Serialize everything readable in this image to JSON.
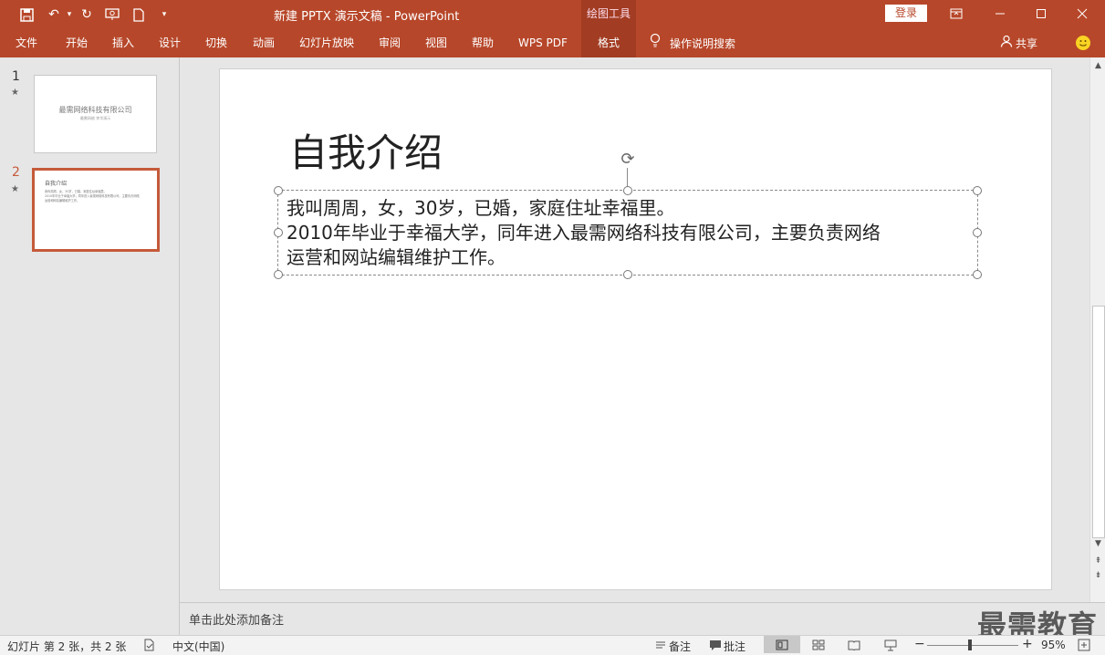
{
  "titlebar": {
    "title": "新建 PPTX 演示文稿  -  PowerPoint",
    "drawing_tools": "绘图工具",
    "login": "登录"
  },
  "ribbon": {
    "tabs": [
      {
        "label": "文件"
      },
      {
        "label": "开始"
      },
      {
        "label": "插入"
      },
      {
        "label": "设计"
      },
      {
        "label": "切换"
      },
      {
        "label": "动画"
      },
      {
        "label": "幻灯片放映"
      },
      {
        "label": "审阅"
      },
      {
        "label": "视图"
      },
      {
        "label": "帮助"
      },
      {
        "label": "WPS PDF"
      },
      {
        "label": "格式"
      }
    ],
    "tell_me": "操作说明搜索",
    "share": "共享"
  },
  "thumbnails": [
    {
      "number": "1",
      "title": "最需网络科技有限公司",
      "subtitle": "最需网络  李华演示"
    },
    {
      "number": "2",
      "title": "自我介绍",
      "lines": [
        "我叫周周，女，30岁，已婚，家庭住址幸福里。",
        "2010年毕业于幸福大学，同年进入最需网络科技有限公司，主要负责网络",
        "运营和网站编辑维护工作。"
      ]
    }
  ],
  "slide": {
    "title": "自我介绍",
    "body_lines": [
      "我叫周周，女，30岁，已婚，家庭住址幸福里。",
      "2010年毕业于幸福大学，同年进入最需网络科技有限公司，主要负责网络",
      "运营和网站编辑维护工作。"
    ]
  },
  "notes": {
    "placeholder": "单击此处添加备注",
    "watermark": "最需教育"
  },
  "statusbar": {
    "slide_info": "幻灯片 第 2 张，共 2 张",
    "language": "中文(中国)",
    "notes_btn": "备注",
    "comments_btn": "批注",
    "zoom": "95%"
  },
  "colors": {
    "accent": "#b7472a",
    "selected_thumb_border": "#c55a3a"
  }
}
